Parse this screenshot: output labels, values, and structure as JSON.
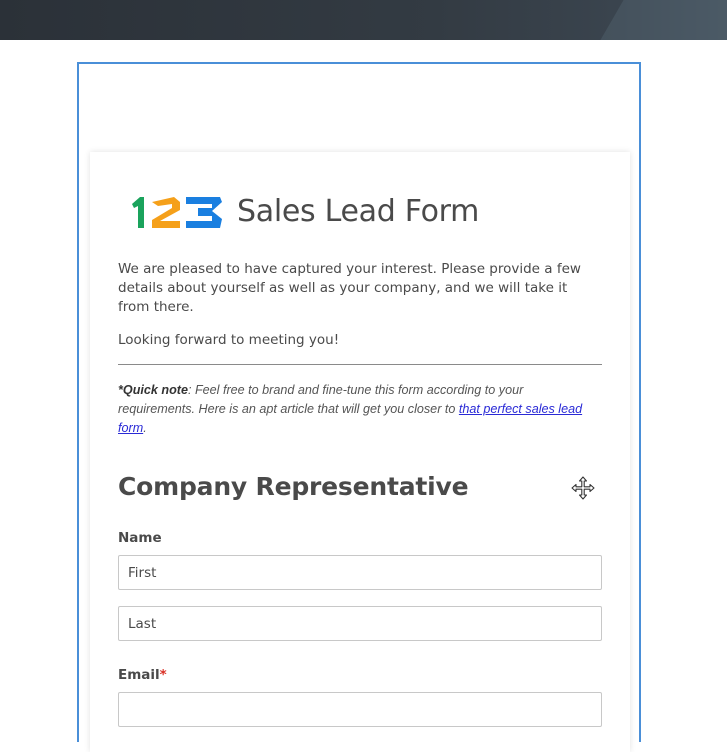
{
  "form": {
    "title": "Sales Lead Form",
    "logo_text": "123",
    "intro": "We are pleased to have captured your interest. Please provide a few details about yourself as well as your company, and we will take it from there.",
    "outro": "Looking forward to meeting you!",
    "quick_note": {
      "label": "*Quick note",
      "text": ": Feel free to brand and fine-tune this form according to your requirements. Here is an apt article that will get you closer to ",
      "link_text": "that perfect sales lead form",
      "suffix": "."
    },
    "section_heading": "Company Representative",
    "fields": {
      "name_label": "Name",
      "first_placeholder": "First",
      "last_placeholder": "Last",
      "email_label": "Email",
      "required_marker": "*"
    }
  },
  "icons": {
    "move": "move-icon"
  },
  "colors": {
    "frame_border": "#4a8fd8",
    "logo_green": "#1aa35c",
    "logo_orange": "#f5a01a",
    "logo_blue": "#1a7fe0",
    "required": "#d93025",
    "link": "#2a2ad6"
  }
}
